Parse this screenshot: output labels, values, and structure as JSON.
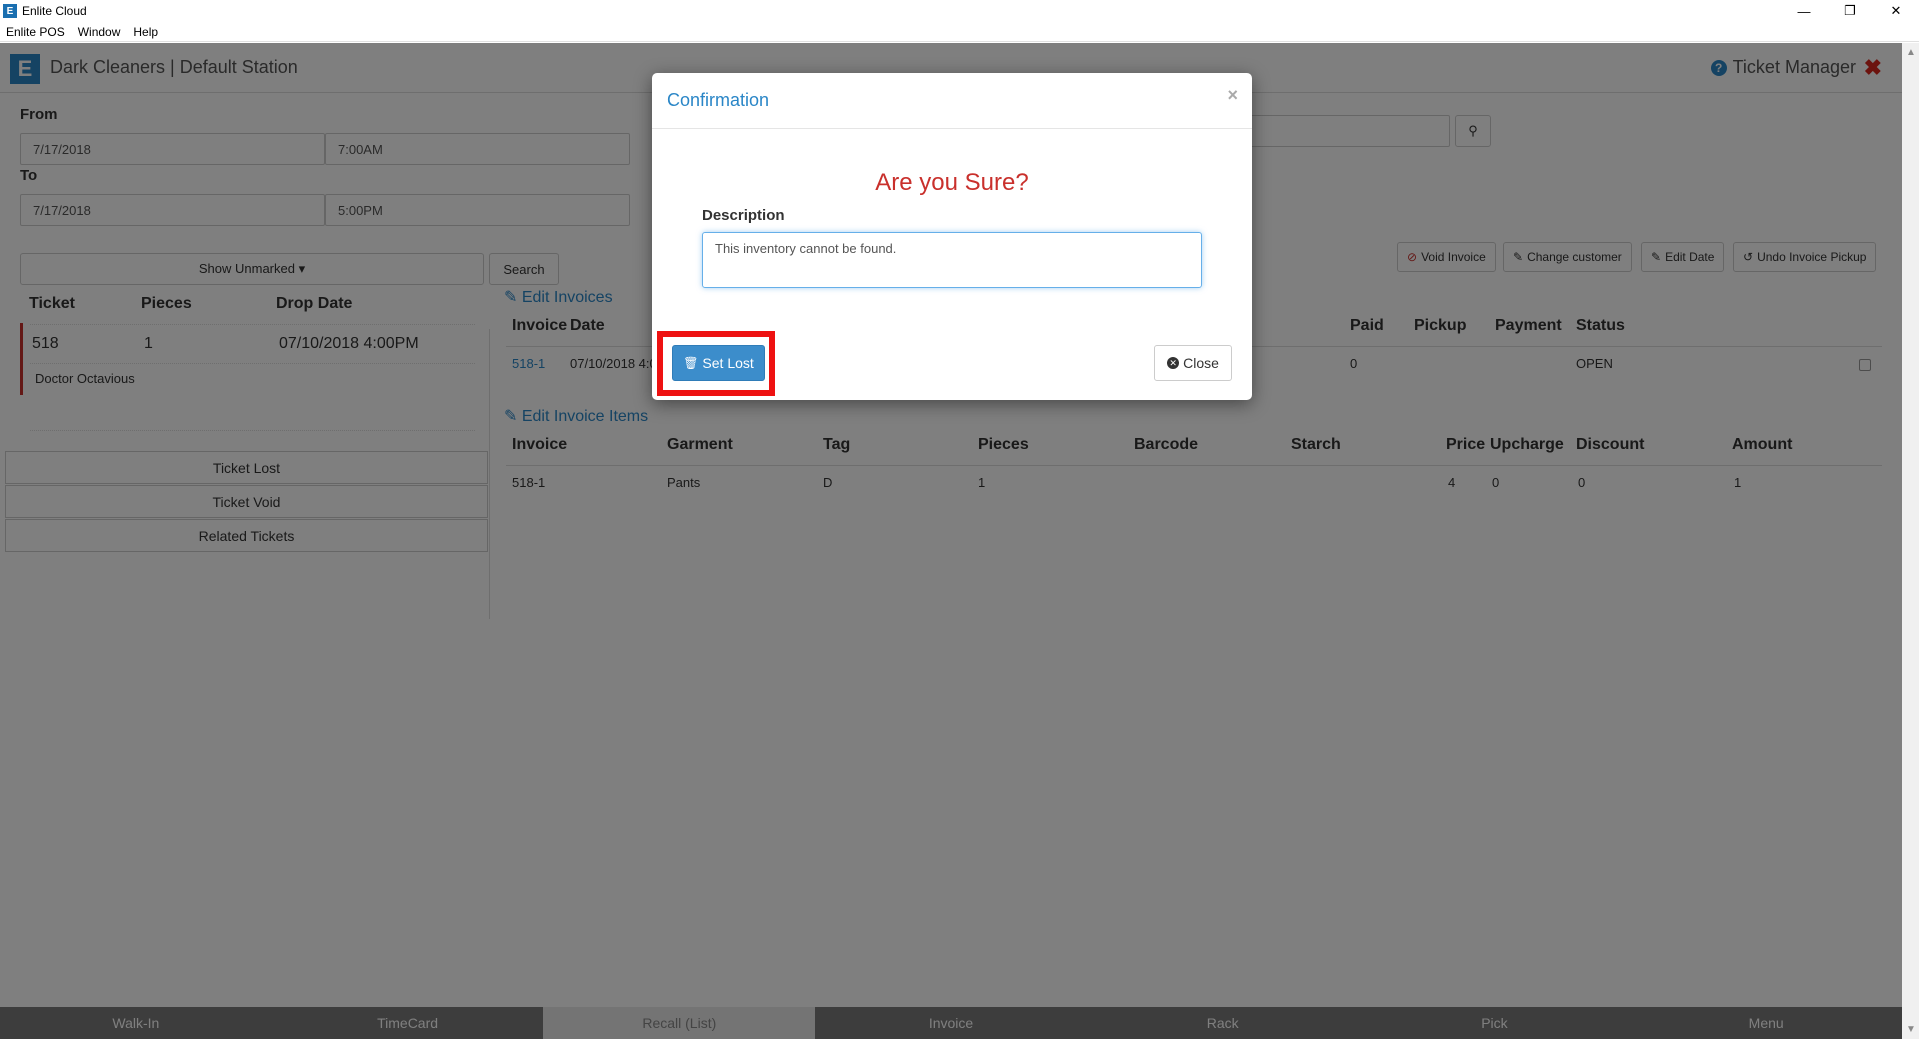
{
  "window": {
    "title": "Enlite Cloud",
    "app_icon": "E",
    "controls": [
      "—",
      "❐",
      "✕"
    ]
  },
  "menubar": [
    "Enlite POS",
    "Window",
    "Help"
  ],
  "header": {
    "brand": "Dark Cleaners | Default Station",
    "page_title": "Ticket Manager",
    "logo": "E"
  },
  "filters": {
    "from_label": "From",
    "from_date": "7/17/2018",
    "from_time": "7:00AM",
    "to_label": "To",
    "to_date": "7/17/2018",
    "to_time": "5:00PM",
    "show_unmarked": "Show Unmarked ▾",
    "search_button": "Search"
  },
  "actions": {
    "void_invoice": "Void Invoice",
    "change_customer": "Change customer",
    "edit_date": "Edit Date",
    "undo_pickup": "Undo Invoice Pickup"
  },
  "tickets": {
    "headers": [
      "Ticket",
      "Pieces",
      "Drop Date"
    ],
    "rows": [
      {
        "ticket": "518",
        "pieces": "1",
        "drop_date": "07/10/2018 4:00PM",
        "customer": "Doctor Octavious"
      }
    ]
  },
  "left_buttons": [
    "Ticket Lost",
    "Ticket Void",
    "Related Tickets"
  ],
  "invoices": {
    "title": "Edit Invoices",
    "headers": [
      "Invoice",
      "Date",
      "Paid",
      "Pickup",
      "Payment",
      "Status"
    ],
    "rows": [
      {
        "invoice": "518-1",
        "date": "07/10/2018 4:0",
        "paid": "0",
        "pickup": "",
        "payment": "",
        "status": "OPEN"
      }
    ]
  },
  "invoice_items": {
    "title": "Edit Invoice Items",
    "headers": [
      "Invoice",
      "Garment",
      "Tag",
      "Pieces",
      "Barcode",
      "Starch",
      "Price",
      "Upcharge",
      "Discount",
      "Amount"
    ],
    "rows": [
      {
        "invoice": "518-1",
        "garment": "Pants",
        "tag": "D",
        "pieces": "1",
        "barcode": "",
        "starch": "",
        "price": "4",
        "upcharge": "0",
        "discount": "0",
        "amount": "1"
      }
    ]
  },
  "bottom_nav": [
    "Walk-In",
    "TimeCard",
    "Recall (List)",
    "Invoice",
    "Rack",
    "Pick",
    "Menu"
  ],
  "bottom_nav_active": "Recall (List)",
  "modal": {
    "title": "Confirmation",
    "question": "Are you Sure?",
    "description_label": "Description",
    "description_value": "This inventory cannot be found.",
    "set_lost": "Set Lost",
    "close": "Close"
  },
  "colors": {
    "accent": "#2a86c7",
    "danger": "#c9302c",
    "highlight": "#ee1111",
    "primary_button": "#3c8dcb"
  }
}
